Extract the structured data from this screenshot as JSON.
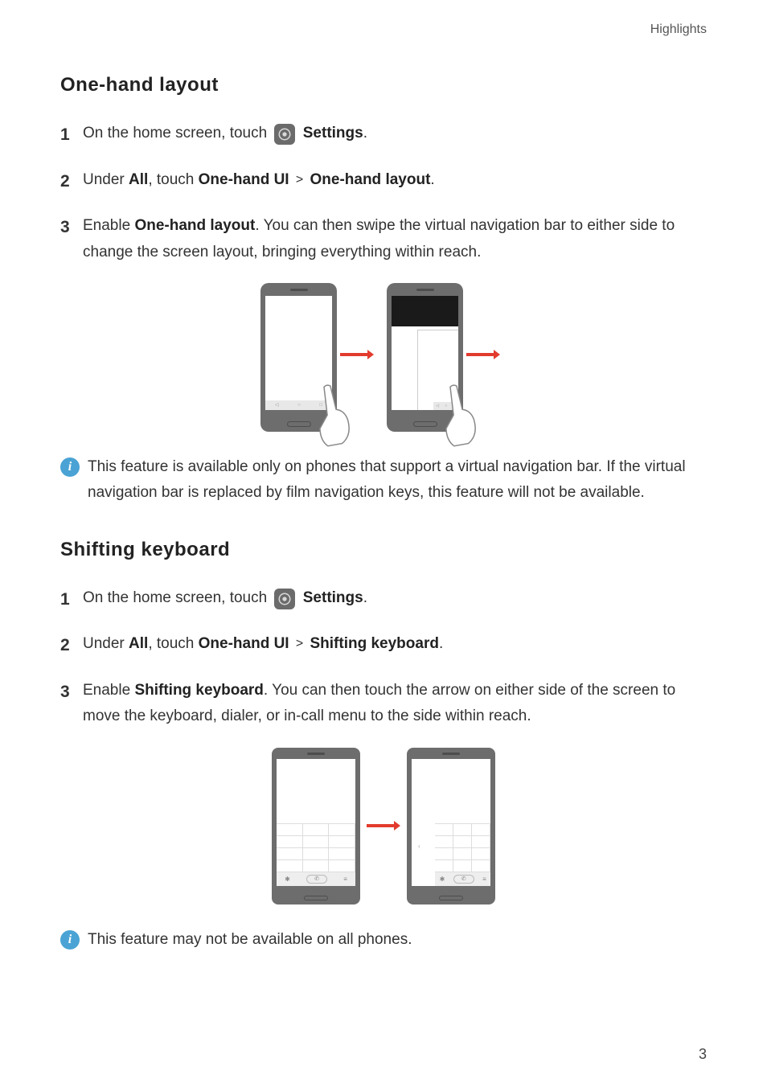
{
  "header": {
    "label": "Highlights"
  },
  "sections": {
    "one_hand": {
      "title": "One-hand layout",
      "steps": [
        {
          "num": "1",
          "prefix": "On the home screen, touch ",
          "icon_label": "Settings",
          "suffix": "."
        },
        {
          "num": "2",
          "text_under": "Under ",
          "all": "All",
          "touch": ", touch ",
          "path1": "One-hand UI",
          "sep": ">",
          "path2": "One-hand layout",
          "end": "."
        },
        {
          "num": "3",
          "enable": "Enable ",
          "feature": "One-hand layout",
          "rest": ". You can then swipe the virtual navigation bar to either side to change the screen layout, bringing everything within reach."
        }
      ],
      "note": "This feature is available only on phones that support a virtual navigation bar. If the virtual navigation bar is replaced by film navigation keys, this feature will not be available."
    },
    "shifting": {
      "title": "Shifting keyboard",
      "steps": [
        {
          "num": "1",
          "prefix": "On the home screen, touch ",
          "icon_label": "Settings",
          "suffix": "."
        },
        {
          "num": "2",
          "text_under": "Under ",
          "all": "All",
          "touch": ", touch ",
          "path1": "One-hand UI",
          "sep": ">",
          "path2": "Shifting keyboard",
          "end": "."
        },
        {
          "num": "3",
          "enable": "Enable ",
          "feature": "Shifting keyboard",
          "rest": ". You can then touch the arrow on either side of the screen to move the keyboard, dialer, or in-call menu to the side within reach."
        }
      ],
      "note": "This feature may not be available on all phones."
    }
  },
  "nav_glyphs": {
    "back": "◁",
    "home": "○",
    "recent": "□"
  },
  "dialer_glyphs": {
    "star": "✱",
    "call": "✆",
    "hash": "≡"
  },
  "info_glyph": "i",
  "page": "3"
}
